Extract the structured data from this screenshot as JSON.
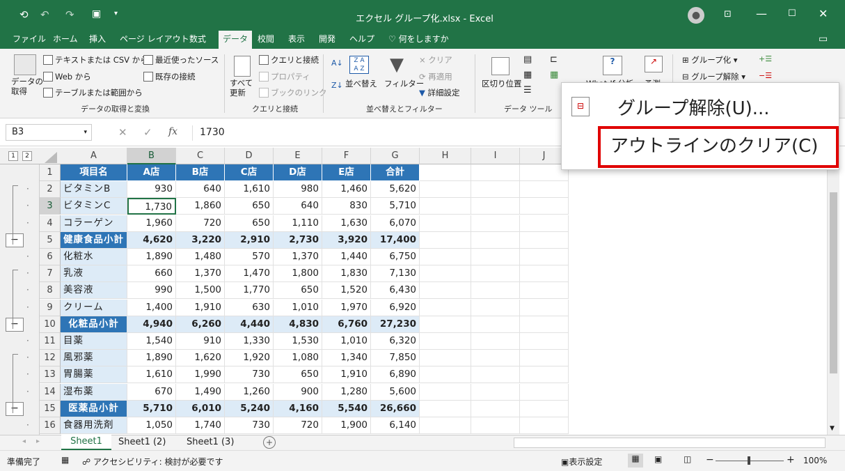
{
  "title": {
    "filename": "エクセル グループ化.xlsx  -  Excel"
  },
  "tabs": [
    "ファイル",
    "ホーム",
    "挿入",
    "ページ レイアウト",
    "数式",
    "データ",
    "校閲",
    "表示",
    "開発",
    "ヘルプ",
    "何をしますか"
  ],
  "ribbon": {
    "get_data": "データの\n取得",
    "text_csv": "テキストまたは CSV から",
    "web": "Web から",
    "table_range": "テーブルまたは範囲から",
    "recent": "最近使ったソース",
    "existing": "既存の接続",
    "group1": "データの取得と変換",
    "refresh_all": "すべて\n更新",
    "queries": "クエリと接続",
    "properties": "プロパティ",
    "edit_links": "ブックのリンク",
    "group2": "クエリと接続",
    "sort": "並べ替え",
    "filter": "フィルター",
    "clear": "クリア",
    "reapply": "再適用",
    "advanced": "詳細設定",
    "group3": "並べ替えとフィルター",
    "text_to_cols": "区切り位置",
    "group4": "データ ツール",
    "whatif": "What-If 分析",
    "forecast": "予測",
    "group": "グループ化",
    "ungroup": "グループ解除"
  },
  "formula": {
    "namebox": "B3",
    "fx": "fx",
    "value": "1730"
  },
  "columns": [
    "A",
    "B",
    "C",
    "D",
    "E",
    "F",
    "G",
    "H",
    "I",
    "J"
  ],
  "outline_levels": [
    "1",
    "2"
  ],
  "table": {
    "header": [
      "項目名",
      "A店",
      "B店",
      "C店",
      "D店",
      "E店",
      "合計"
    ],
    "rows": [
      {
        "r": "2",
        "t": "d",
        "v": [
          "ビタミンB",
          "930",
          "640",
          "1,610",
          "980",
          "1,460",
          "5,620"
        ]
      },
      {
        "r": "3",
        "t": "d",
        "v": [
          "ビタミンC",
          "1,730",
          "1,860",
          "650",
          "640",
          "830",
          "5,710"
        ]
      },
      {
        "r": "4",
        "t": "d",
        "v": [
          "コラーゲン",
          "1,960",
          "720",
          "650",
          "1,110",
          "1,630",
          "6,070"
        ]
      },
      {
        "r": "5",
        "t": "s",
        "v": [
          "健康食品小計",
          "4,620",
          "3,220",
          "2,910",
          "2,730",
          "3,920",
          "17,400"
        ]
      },
      {
        "r": "6",
        "t": "d",
        "v": [
          "化粧水",
          "1,890",
          "1,480",
          "570",
          "1,370",
          "1,440",
          "6,750"
        ]
      },
      {
        "r": "7",
        "t": "d",
        "v": [
          "乳液",
          "660",
          "1,370",
          "1,470",
          "1,800",
          "1,830",
          "7,130"
        ]
      },
      {
        "r": "8",
        "t": "d",
        "v": [
          "美容液",
          "990",
          "1,500",
          "1,770",
          "650",
          "1,520",
          "6,430"
        ]
      },
      {
        "r": "9",
        "t": "d",
        "v": [
          "クリーム",
          "1,400",
          "1,910",
          "630",
          "1,010",
          "1,970",
          "6,920"
        ]
      },
      {
        "r": "10",
        "t": "s",
        "v": [
          "化粧品小計",
          "4,940",
          "6,260",
          "4,440",
          "4,830",
          "6,760",
          "27,230"
        ]
      },
      {
        "r": "11",
        "t": "d",
        "v": [
          "目薬",
          "1,540",
          "910",
          "1,330",
          "1,530",
          "1,010",
          "6,320"
        ]
      },
      {
        "r": "12",
        "t": "d",
        "v": [
          "風邪薬",
          "1,890",
          "1,620",
          "1,920",
          "1,080",
          "1,340",
          "7,850"
        ]
      },
      {
        "r": "13",
        "t": "d",
        "v": [
          "胃腸薬",
          "1,610",
          "1,990",
          "730",
          "650",
          "1,910",
          "6,890"
        ]
      },
      {
        "r": "14",
        "t": "d",
        "v": [
          "湿布薬",
          "670",
          "1,490",
          "1,260",
          "900",
          "1,280",
          "5,600"
        ]
      },
      {
        "r": "15",
        "t": "s",
        "v": [
          "医薬品小計",
          "5,710",
          "6,010",
          "5,240",
          "4,160",
          "5,540",
          "26,660"
        ]
      },
      {
        "r": "16",
        "t": "d",
        "v": [
          "食器用洗剤",
          "1,050",
          "1,740",
          "730",
          "720",
          "1,900",
          "6,140"
        ]
      }
    ]
  },
  "sheets": [
    "Sheet1",
    "Sheet1 (2)",
    "Sheet1 (3)"
  ],
  "status": {
    "ready": "準備完了",
    "accessibility": "アクセシビリティ: 検討が必要です",
    "display": "表示設定",
    "zoom": "100%"
  },
  "popup": {
    "ungroup": "グループ解除(U)...",
    "clear_outline": "アウトラインのクリア(C)"
  },
  "colors": {
    "excel_green": "#217346",
    "header_blue": "#2e75b6",
    "label_blue": "#ddebf7",
    "highlight_red": "#e00000"
  }
}
